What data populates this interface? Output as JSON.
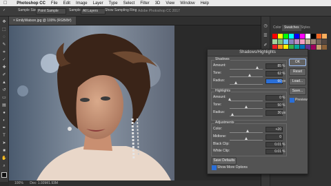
{
  "menubar": {
    "apple": "",
    "app": "Photoshop CC",
    "items": [
      "File",
      "Edit",
      "Image",
      "Layer",
      "Type",
      "Select",
      "Filter",
      "3D",
      "View",
      "Window",
      "Help"
    ]
  },
  "options": {
    "sample_size_label": "Sample Size:",
    "sample_size_value": "Point Sample",
    "sample_label": "Sample:",
    "sample_value": "All Layers",
    "show_ring": "Show Sampling Ring",
    "app_title": "Adobe Photoshop CC 2017"
  },
  "document": {
    "tab_label": "EmilyWatson.jpg @ 100% (RGB/8#)",
    "status_zoom": "100%",
    "status_doc": "Doc: 1.93M/1.93M"
  },
  "dialog": {
    "title": "Shadows/Highlights",
    "shadows": {
      "label": "Shadows",
      "amount_label": "Amount:",
      "amount": "85",
      "tone_label": "Tone:",
      "tone": "62",
      "radius_label": "Radius:",
      "radius": "60"
    },
    "highlights": {
      "label": "Highlights",
      "amount_label": "Amount:",
      "amount": "0",
      "tone_label": "Tone:",
      "tone": "50",
      "radius_label": "Radius:",
      "radius": "30"
    },
    "adjustments": {
      "label": "Adjustments",
      "color_label": "Color:",
      "color": "+20",
      "midtone_label": "Midtone:",
      "midtone": "0",
      "black_label": "Black Clip:",
      "black": "0.01",
      "white_label": "White Clip:",
      "white": "0.01"
    },
    "units": {
      "percent": "%",
      "px": "px"
    },
    "buttons": {
      "ok": "OK",
      "reset": "Reset",
      "load": "Load...",
      "save": "Save...",
      "preview": "Preview",
      "save_defaults": "Save Defaults",
      "show_more": "Show More Options"
    },
    "slider_levels": {
      "sh_amount": 0.85,
      "sh_tone": 0.62,
      "sh_radius": 0.2,
      "hl_amount": 0.0,
      "hl_tone": 0.5,
      "hl_radius": 0.1,
      "color": 0.55,
      "midtone": 0.5
    },
    "preview_checked": true,
    "show_more_checked": true
  },
  "panels": {
    "tabs": [
      "Color",
      "Swatches",
      "Styles"
    ],
    "active_tab": "Swatches"
  },
  "colors": {
    "selection_blue": "#2a6fd8",
    "swatches": [
      "#ff0000",
      "#ffff00",
      "#00ff00",
      "#00ffff",
      "#0000ff",
      "#ff00ff",
      "#ffffff",
      "#000000",
      "#f26522",
      "#fbaf5d",
      "#a3d39c",
      "#7cc576",
      "#6dcff6",
      "#8781bd",
      "#bd8cbf",
      "#f49ac1",
      "#c7b299",
      "#998675",
      "#736357",
      "#534741",
      "#ed1c24",
      "#f7941d",
      "#fff200",
      "#39b54a",
      "#00a99d",
      "#0072bc",
      "#662d91",
      "#9e005d",
      "#c69c6d",
      "#8c6239"
    ]
  }
}
